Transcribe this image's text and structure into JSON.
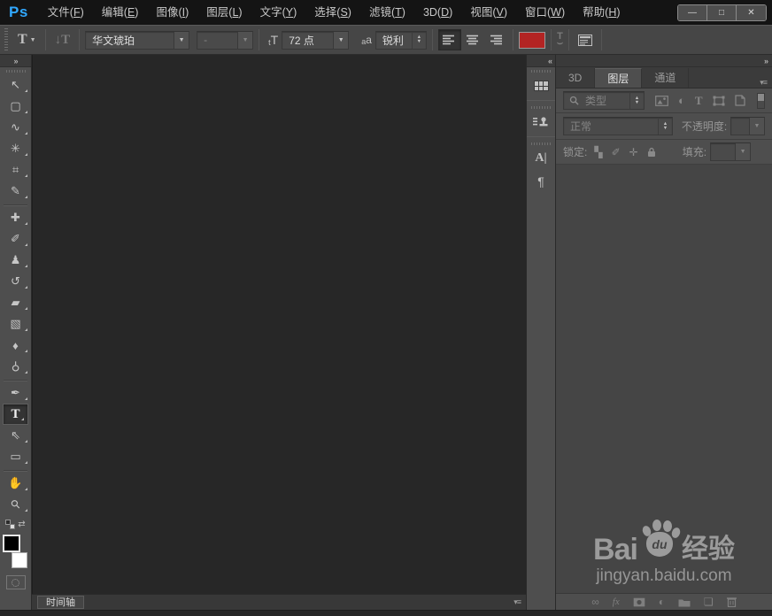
{
  "menu_bar": {
    "logo": "Ps",
    "items": [
      "文件(F)",
      "编辑(E)",
      "图像(I)",
      "图层(L)",
      "文字(Y)",
      "选择(S)",
      "滤镜(T)",
      "3D(D)",
      "视图(V)",
      "窗口(W)",
      "帮助(H)"
    ]
  },
  "window_controls": {
    "minimize": "—",
    "maximize": "□",
    "close": "✕"
  },
  "options_bar": {
    "tool_glyph": "T",
    "orientation_glyph": "↓T",
    "font_family": "华文琥珀",
    "font_style": "-",
    "size_icon_small": "t",
    "size_icon_big": "T",
    "font_size": "72 点",
    "aa_icon_small": "a",
    "aa_icon_big": "a",
    "anti_alias": "锐利",
    "text_color": "#b32423",
    "warp_top": "T",
    "warp_bottom": "⌣"
  },
  "toolbar": {
    "collapse_glyph": "»",
    "tools": [
      {
        "name": "move-tool",
        "glyph": "↖"
      },
      {
        "name": "rectangular-marquee-tool",
        "glyph": "▢"
      },
      {
        "name": "lasso-tool",
        "glyph": "∿"
      },
      {
        "name": "magic-wand-tool",
        "glyph": "✳"
      },
      {
        "name": "crop-tool",
        "glyph": "⌗"
      },
      {
        "name": "eyedropper-tool",
        "glyph": "✎"
      },
      {
        "name": "spot-healing-brush-tool",
        "glyph": "✚"
      },
      {
        "name": "brush-tool",
        "glyph": "✐"
      },
      {
        "name": "clone-stamp-tool",
        "glyph": "♟"
      },
      {
        "name": "history-brush-tool",
        "glyph": "↺"
      },
      {
        "name": "eraser-tool",
        "glyph": "▰"
      },
      {
        "name": "gradient-tool",
        "glyph": "▧"
      },
      {
        "name": "blur-tool",
        "glyph": "♦"
      },
      {
        "name": "dodge-tool",
        "glyph": "⚲"
      },
      {
        "name": "pen-tool",
        "glyph": "✒"
      },
      {
        "name": "type-tool",
        "glyph": "T"
      },
      {
        "name": "path-selection-tool",
        "glyph": "⇖"
      },
      {
        "name": "rectangle-tool",
        "glyph": "▭"
      },
      {
        "name": "hand-tool",
        "glyph": "✋"
      },
      {
        "name": "zoom-tool",
        "glyph": "⚲"
      }
    ],
    "swap_glyph": "⇄"
  },
  "timeline": {
    "tab": "时间轴",
    "menu_glyph": "▾≡"
  },
  "dock": {
    "collapse_glyph": "«",
    "character_glyph": "A|",
    "paragraph_glyph": "¶"
  },
  "layers_panel": {
    "expand_glyph": "»",
    "menu_glyph": "▾≡",
    "tabs": [
      "3D",
      "图层",
      "通道"
    ],
    "active_tab": "图层",
    "filter_label": "类型",
    "type_filter_glyph": "T",
    "adjustment_filter_glyph": "◐",
    "blend_mode": "正常",
    "opacity_label": "不透明度:",
    "lock_label": "锁定:",
    "lock_transparency_glyph": "▚",
    "lock_paint_glyph": "✐",
    "lock_move_glyph": "✛",
    "fill_label": "填充:",
    "fx_label": "fx",
    "link_glyph": "∞",
    "new_layer_glyph": "❏"
  },
  "watermark": {
    "bai": "Bai",
    "du": "du",
    "suffix": "经验",
    "url": "jingyan.baidu.com"
  }
}
